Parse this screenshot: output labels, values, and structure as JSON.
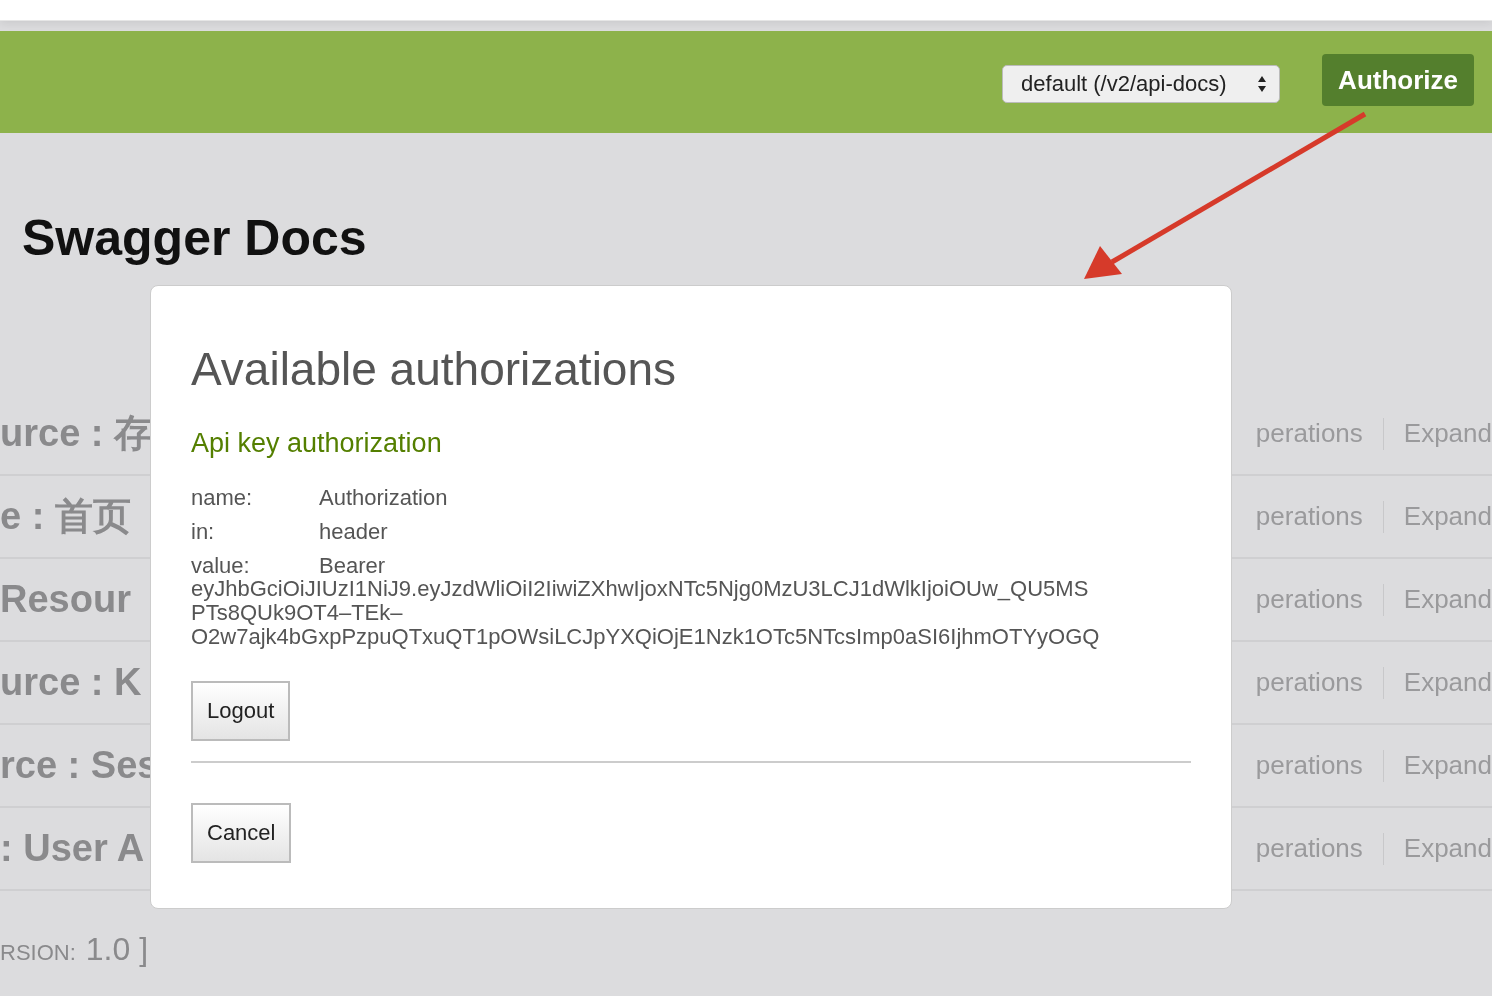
{
  "header": {
    "spec_select": {
      "value": "default (/v2/api-docs)"
    },
    "authorize_button": "Authorize"
  },
  "page_title": "Swagger Docs",
  "resources": [
    {
      "name": "urce : 存",
      "operations": "perations",
      "expand": "Expand"
    },
    {
      "name": "e : 首页",
      "operations": "perations",
      "expand": "Expand"
    },
    {
      "name": "Resour",
      "operations": "perations",
      "expand": "Expand"
    },
    {
      "name": "urce : K",
      "operations": "perations",
      "expand": "Expand"
    },
    {
      "name": "rce : Ses",
      "operations": "perations",
      "expand": "Expand"
    },
    {
      "name": ": User A",
      "operations": "perations",
      "expand": "Expand"
    }
  ],
  "footer": {
    "label": "RSION:",
    "version": "1.0 ]"
  },
  "dialog": {
    "title": "Available authorizations",
    "section": "Api key authorization",
    "fields": [
      {
        "label": "name:",
        "value": "Authorization"
      },
      {
        "label": "in:",
        "value": "header"
      }
    ],
    "value_label": "value:",
    "value_lines": [
      "Bearer",
      "eyJhbGciOiJIUzI1NiJ9.eyJzdWliOiI2IiwiZXhwIjoxNTc5Njg0MzU3LCJ1dWlkIjoiOUw_QU5MS",
      "PTs8QUk9OT4–TEk–",
      "O2w7ajk4bGxpPzpuQTxuQT1pOWsiLCJpYXQiOjE1Nzk1OTc5NTcsImp0aSI6IjhmOTYyOGQ"
    ],
    "logout_button": "Logout",
    "cancel_button": "Cancel"
  }
}
